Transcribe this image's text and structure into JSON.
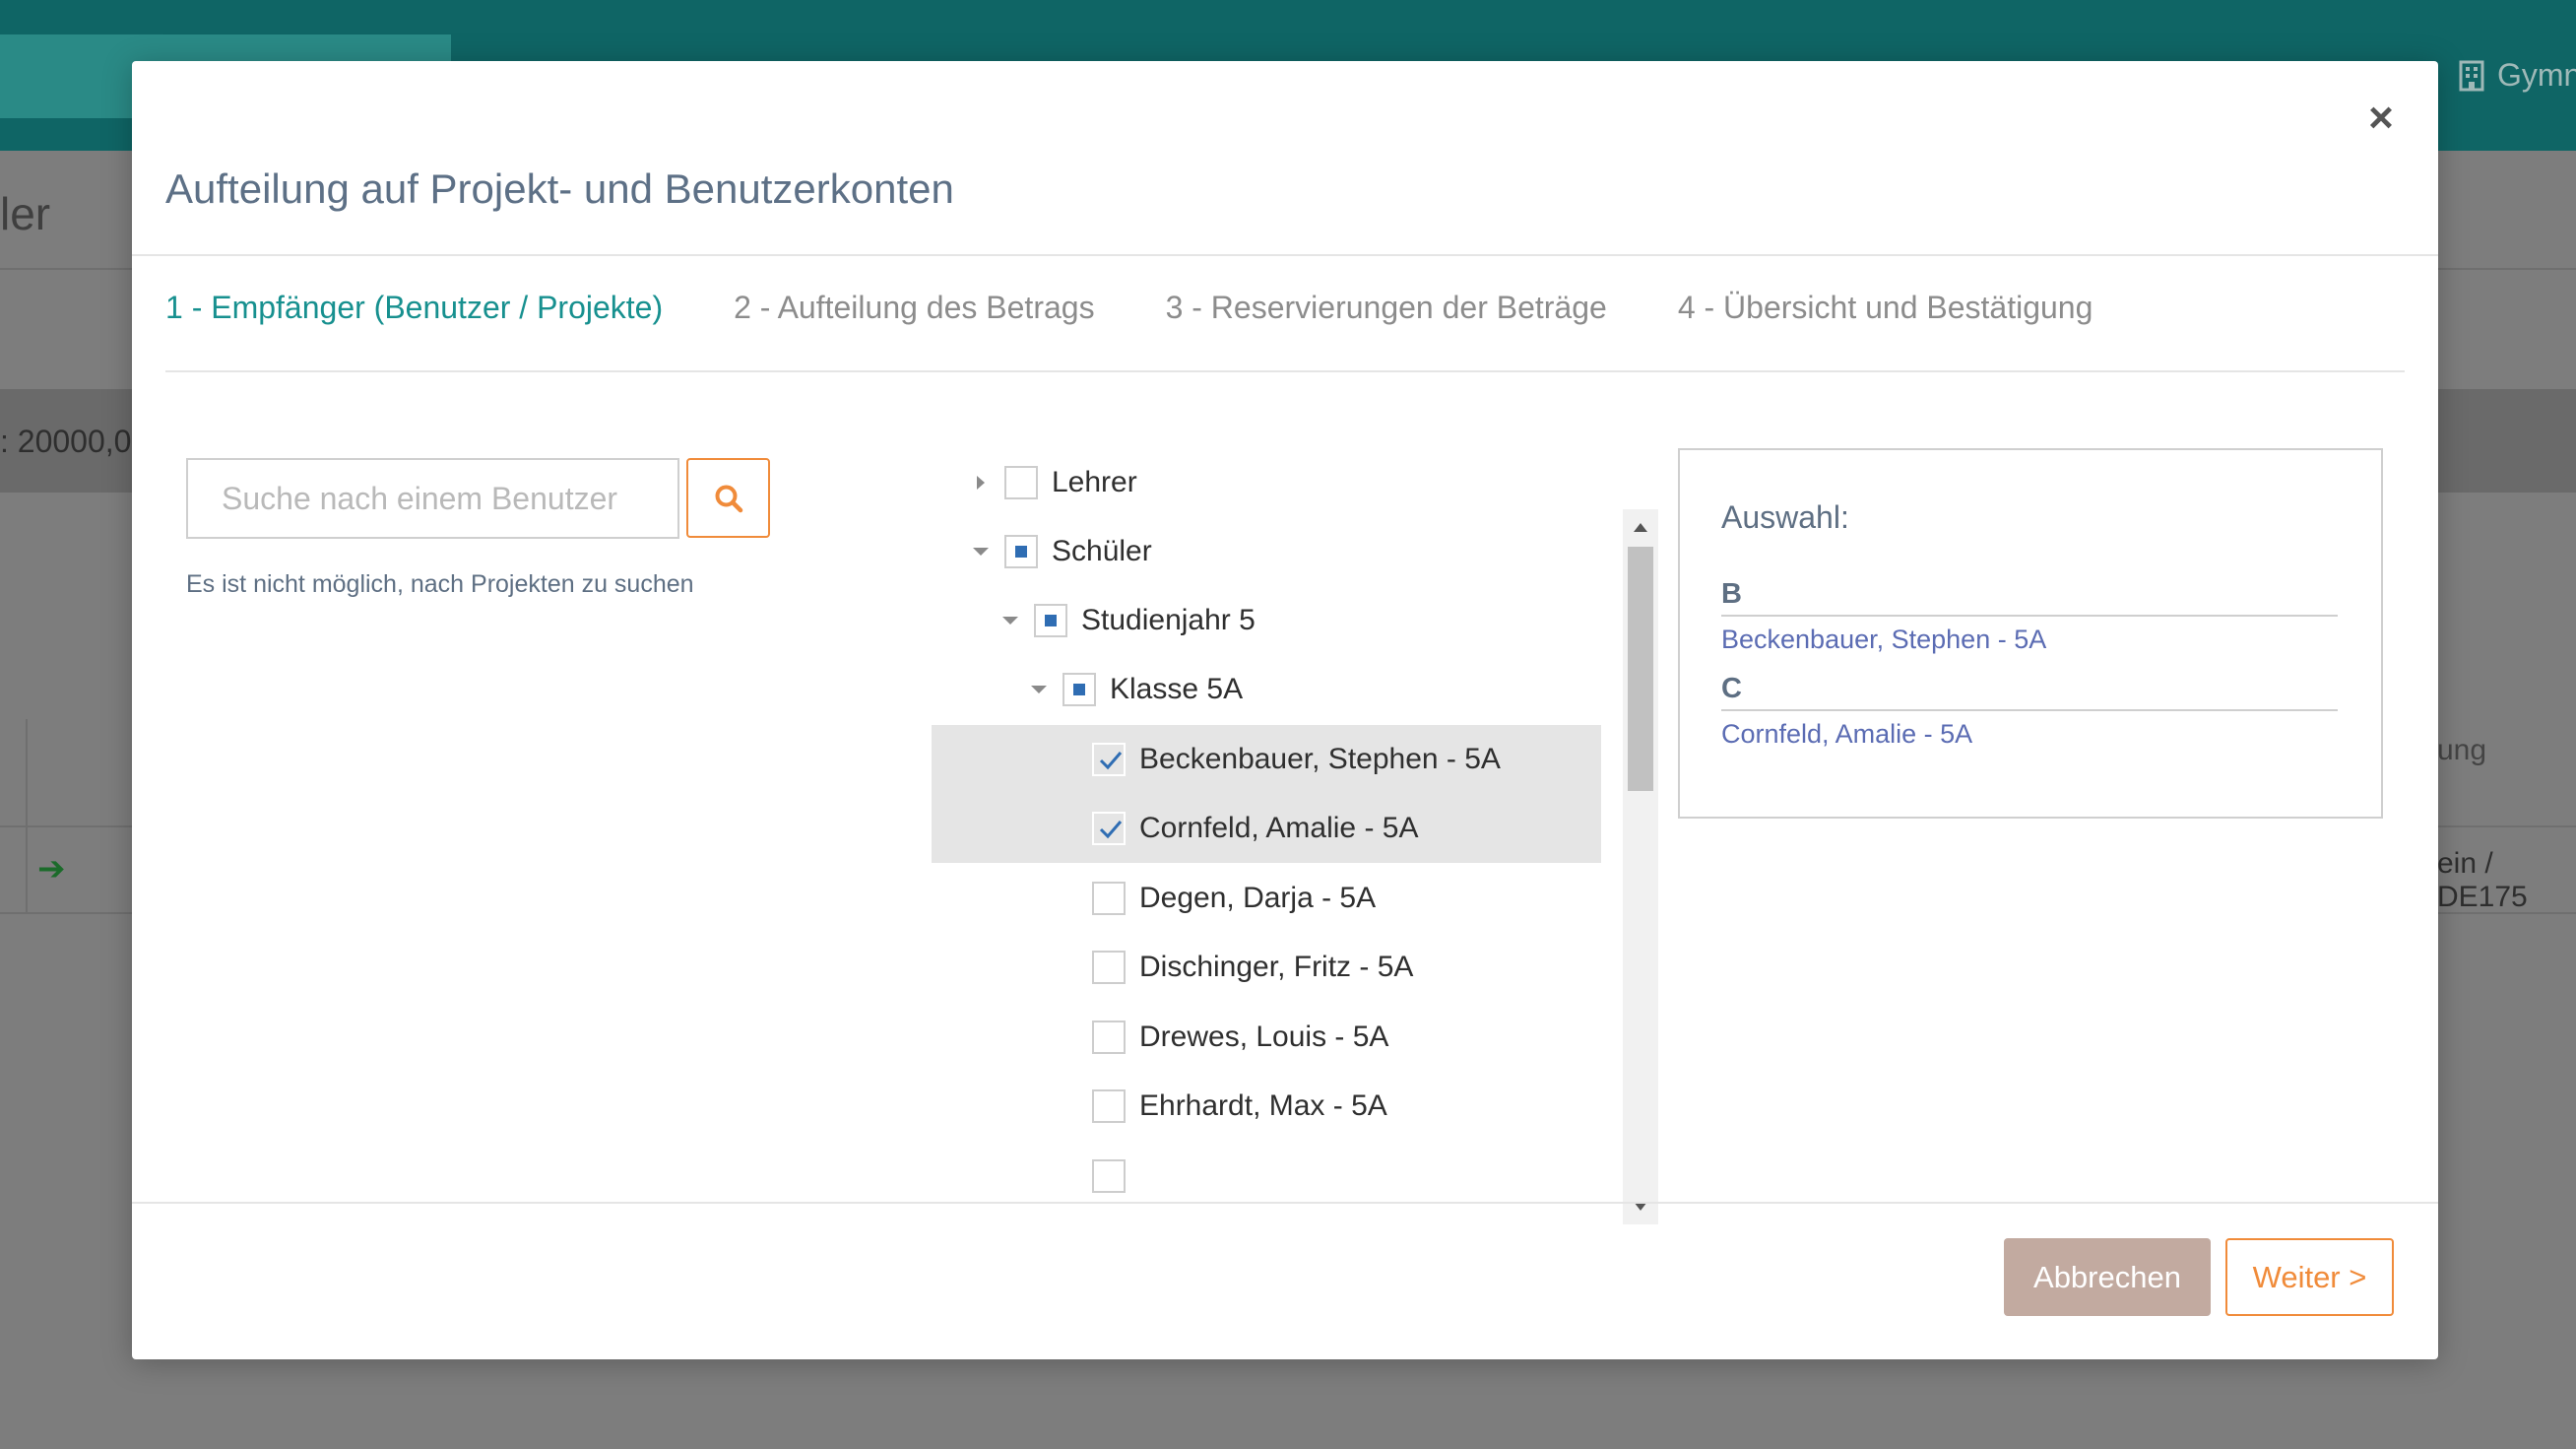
{
  "background": {
    "org_name": "Gymn",
    "page_title": "ler",
    "amount_text": ": 20000,0",
    "column_fragment": "ung",
    "row_fragment": "ein / DE175"
  },
  "modal": {
    "title": "Aufteilung auf Projekt- und Benutzerkonten",
    "close_symbol": "×",
    "steps": [
      {
        "label": "1 - Empfänger (Benutzer / Projekte)",
        "active": true
      },
      {
        "label": "2 - Aufteilung des Betrags",
        "active": false
      },
      {
        "label": "3 - Reservierungen der Beträge",
        "active": false
      },
      {
        "label": "4 - Übersicht und Bestätigung",
        "active": false
      }
    ],
    "search": {
      "placeholder": "Suche nach einem Benutzer",
      "value": "",
      "hint": "Es ist nicht möglich, nach Projekten zu suchen"
    },
    "tree": [
      {
        "label": "Lehrer",
        "expanded": false,
        "state": "unchecked"
      },
      {
        "label": "Schüler",
        "expanded": true,
        "state": "partial"
      },
      {
        "label": "Studienjahr 5",
        "expanded": true,
        "state": "partial"
      },
      {
        "label": "Klasse 5A",
        "expanded": true,
        "state": "partial"
      },
      {
        "label": "Beckenbauer, Stephen - 5A",
        "state": "checked"
      },
      {
        "label": "Cornfeld, Amalie - 5A",
        "state": "checked"
      },
      {
        "label": "Degen, Darja - 5A",
        "state": "unchecked"
      },
      {
        "label": "Dischinger, Fritz - 5A",
        "state": "unchecked"
      },
      {
        "label": "Drewes, Louis - 5A",
        "state": "unchecked"
      },
      {
        "label": "Ehrhardt, Max - 5A",
        "state": "unchecked"
      }
    ],
    "selection": {
      "title": "Auswahl:",
      "groups": [
        {
          "letter": "B",
          "items": [
            "Beckenbauer, Stephen - 5A"
          ]
        },
        {
          "letter": "C",
          "items": [
            "Cornfeld, Amalie - 5A"
          ]
        }
      ]
    },
    "footer": {
      "cancel_label": "Abbrechen",
      "next_label": "Weiter >"
    }
  },
  "colors": {
    "teal_header": "#0f6565",
    "active_step": "#17908f",
    "accent_orange": "#f08b3a",
    "cancel_bg": "#c2aaa0",
    "checkbox_blue": "#2f6db3",
    "selection_link": "#5b6cb3"
  },
  "icons": {
    "close": "close-icon",
    "search": "search-icon",
    "expand": "caret-icon",
    "check": "checkmark-icon",
    "org": "building-icon",
    "row_action": "arrow-right-icon"
  }
}
